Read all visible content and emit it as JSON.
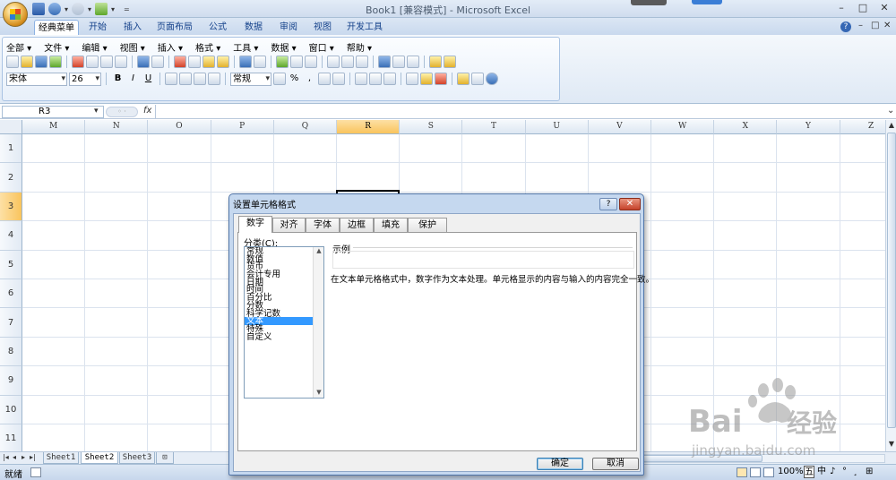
{
  "window": {
    "title": "Book1  [兼容模式] - Microsoft Excel",
    "min": "–",
    "max": "□",
    "close": "✕"
  },
  "qat": {
    "more": "▾",
    "customize": "="
  },
  "ribbon_tabs": [
    "经典菜单",
    "开始",
    "插入",
    "页面布局",
    "公式",
    "数据",
    "审阅",
    "视图",
    "开发工具"
  ],
  "ribbon_controls": {
    "help": "?",
    "min": "–",
    "restore": "□",
    "close": "✕"
  },
  "menus": [
    "全部 ▾",
    "文件 ▾",
    "编辑 ▾",
    "视图 ▾",
    "插入 ▾",
    "格式 ▾",
    "工具 ▾",
    "数据 ▾",
    "窗口 ▾",
    "帮助 ▾"
  ],
  "toolbar": {
    "font_name": "宋体",
    "font_size": "26",
    "bold": "B",
    "italic": "I",
    "underline": "U",
    "number_format": "常规",
    "percent": "%",
    "comma": ","
  },
  "formula_bar": {
    "name_box": "R3",
    "fx": "fx",
    "value": ""
  },
  "columns": [
    "M",
    "N",
    "O",
    "P",
    "Q",
    "R",
    "S",
    "T",
    "U",
    "V",
    "W",
    "X",
    "Y",
    "Z"
  ],
  "selected_column": "R",
  "rows": [
    "1",
    "2",
    "3",
    "4",
    "5",
    "6",
    "7",
    "8",
    "9",
    "10",
    "11"
  ],
  "selected_row": "3",
  "sheets": [
    "Sheet1",
    "Sheet2",
    "Sheet3"
  ],
  "active_sheet": "Sheet2",
  "sheet_nav": [
    "|◂",
    "◂",
    "▸",
    "▸|"
  ],
  "status": {
    "ready": "就绪",
    "zoom": "100%",
    "ime": [
      "中",
      "♪",
      "°",
      "¸",
      "⊞"
    ]
  },
  "dialog": {
    "title": "设置单元格格式",
    "help": "?",
    "close": "✕",
    "tabs": [
      "数字",
      "对齐",
      "字体",
      "边框",
      "填充",
      "保护"
    ],
    "active_tab": "数字",
    "category_label": "分类(C):",
    "categories": [
      "常规",
      "数值",
      "货币",
      "会计专用",
      "日期",
      "时间",
      "百分比",
      "分数",
      "科学记数",
      "文本",
      "特殊",
      "自定义"
    ],
    "selected_category": "文本",
    "sample_label": "示例",
    "description": "在文本单元格格式中，数字作为文本处理。单元格显示的内容与输入的内容完全一致。",
    "ok": "确定",
    "cancel": "取消"
  },
  "watermark": {
    "brand": "Bai",
    "brand2": "经验",
    "url": "jingyan.baidu.com"
  }
}
